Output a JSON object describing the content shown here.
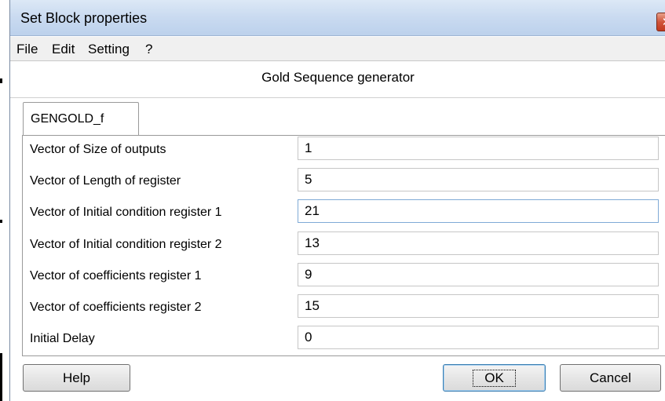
{
  "window": {
    "title": "Set Block properties",
    "close_glyph": "✕"
  },
  "menu": {
    "items": [
      "File",
      "Edit",
      "Setting",
      "?"
    ]
  },
  "block_title": "Gold Sequence generator",
  "tab": {
    "label": "GENGOLD_f"
  },
  "fields": [
    {
      "label": "Vector of Size of outputs",
      "value": "1"
    },
    {
      "label": "Vector of Length of register",
      "value": "5"
    },
    {
      "label": "Vector of Initial condition register 1",
      "value": "21"
    },
    {
      "label": "Vector of Initial condition register 2",
      "value": "13"
    },
    {
      "label": "Vector of coefficients register 1",
      "value": "9"
    },
    {
      "label": "Vector of coefficients register 2",
      "value": "15"
    },
    {
      "label": "Initial Delay",
      "value": "0"
    }
  ],
  "buttons": {
    "help": "Help",
    "ok": "OK",
    "cancel": "Cancel"
  }
}
